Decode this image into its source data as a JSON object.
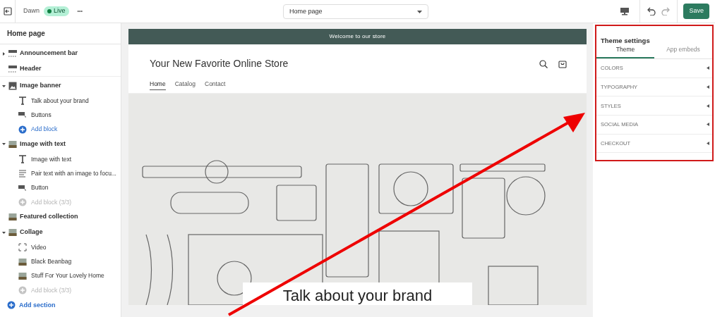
{
  "topbar": {
    "theme_name": "Dawn",
    "status_badge": "Live",
    "more": "•••",
    "page_select": "Home page",
    "save_button": "Save"
  },
  "sidebar": {
    "title": "Home page",
    "sections": [
      {
        "label": "Announcement bar",
        "kind": "bar",
        "expanded": false
      },
      {
        "label": "Header",
        "kind": "bar"
      },
      {
        "label": "Image banner",
        "kind": "image",
        "expanded": true,
        "children": [
          {
            "label": "Talk about your brand",
            "kind": "text"
          },
          {
            "label": "Buttons",
            "kind": "button"
          },
          {
            "label": "Add block",
            "kind": "add",
            "disabled": false
          }
        ]
      },
      {
        "label": "Image with text",
        "kind": "photo",
        "expanded": true,
        "children": [
          {
            "label": "Image with text",
            "kind": "text"
          },
          {
            "label": "Pair text with an image to focu...",
            "kind": "paragraph"
          },
          {
            "label": "Button",
            "kind": "button"
          },
          {
            "label": "Add block (3/3)",
            "kind": "add",
            "disabled": true
          }
        ]
      },
      {
        "label": "Featured collection",
        "kind": "photo"
      },
      {
        "label": "Collage",
        "kind": "photo",
        "expanded": true,
        "children": [
          {
            "label": "Video",
            "kind": "video"
          },
          {
            "label": "Black Beanbag",
            "kind": "photo"
          },
          {
            "label": "Stuff For Your Lovely Home",
            "kind": "photo"
          },
          {
            "label": "Add block (3/3)",
            "kind": "add",
            "disabled": true
          }
        ]
      }
    ],
    "add_section": "Add section"
  },
  "preview": {
    "announcement": "Welcome to our store",
    "store_title": "Your New Favorite Online Store",
    "nav": [
      {
        "label": "Home",
        "selected": true
      },
      {
        "label": "Catalog",
        "selected": false
      },
      {
        "label": "Contact",
        "selected": false
      }
    ],
    "banner_heading": "Talk about your brand"
  },
  "theme_settings": {
    "title": "Theme settings",
    "tabs": [
      {
        "label": "Theme",
        "selected": true
      },
      {
        "label": "App embeds",
        "selected": false
      }
    ],
    "groups": [
      {
        "label": "COLORS",
        "expanded": false
      },
      {
        "label": "TYPOGRAPHY",
        "expanded": false
      },
      {
        "label": "STYLES",
        "expanded": false
      },
      {
        "label": "SOCIAL MEDIA",
        "expanded": false
      },
      {
        "label": "CHECKOUT",
        "expanded": false
      }
    ]
  }
}
